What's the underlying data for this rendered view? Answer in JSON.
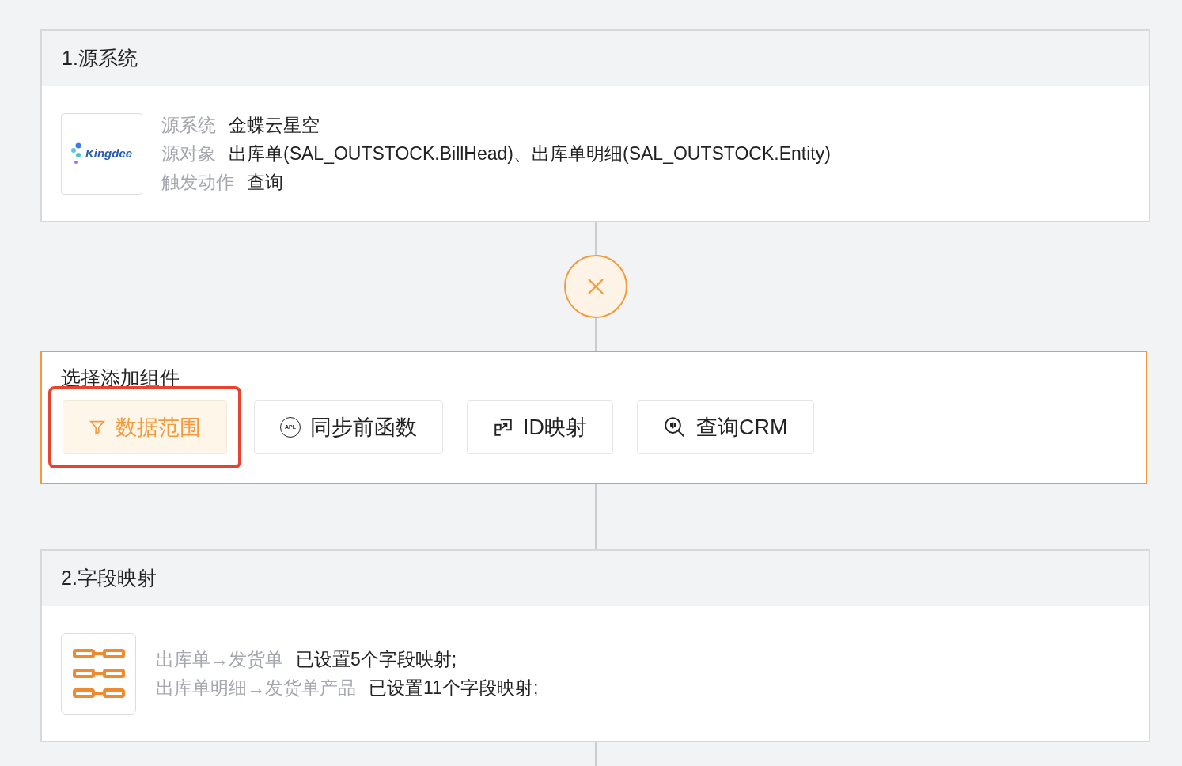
{
  "source_card": {
    "title": "1.源系统",
    "logo_text": "Kingdee",
    "fields": [
      {
        "label": "源系统",
        "value": "金蝶云星空"
      },
      {
        "label": "源对象",
        "value": "出库单(SAL_OUTSTOCK.BillHead)、出库单明细(SAL_OUTSTOCK.Entity)"
      },
      {
        "label": "触发动作",
        "value": "查询"
      }
    ]
  },
  "connector_button": {
    "kind": "close"
  },
  "component_picker": {
    "title": "选择添加组件",
    "options": [
      {
        "kind": "filter",
        "label": "数据范围",
        "selected": true
      },
      {
        "kind": "apl",
        "label": "同步前函数",
        "selected": false,
        "icon_text": "APL"
      },
      {
        "kind": "mapping",
        "label": "ID映射",
        "selected": false
      },
      {
        "kind": "search",
        "label": "查询CRM",
        "selected": false
      }
    ]
  },
  "mapping_card": {
    "title": "2.字段映射",
    "rows": [
      {
        "label": "出库单→发货单",
        "value": "已设置5个字段映射;"
      },
      {
        "label": "出库单明细→发货单产品",
        "value": "已设置11个字段映射;"
      }
    ]
  }
}
